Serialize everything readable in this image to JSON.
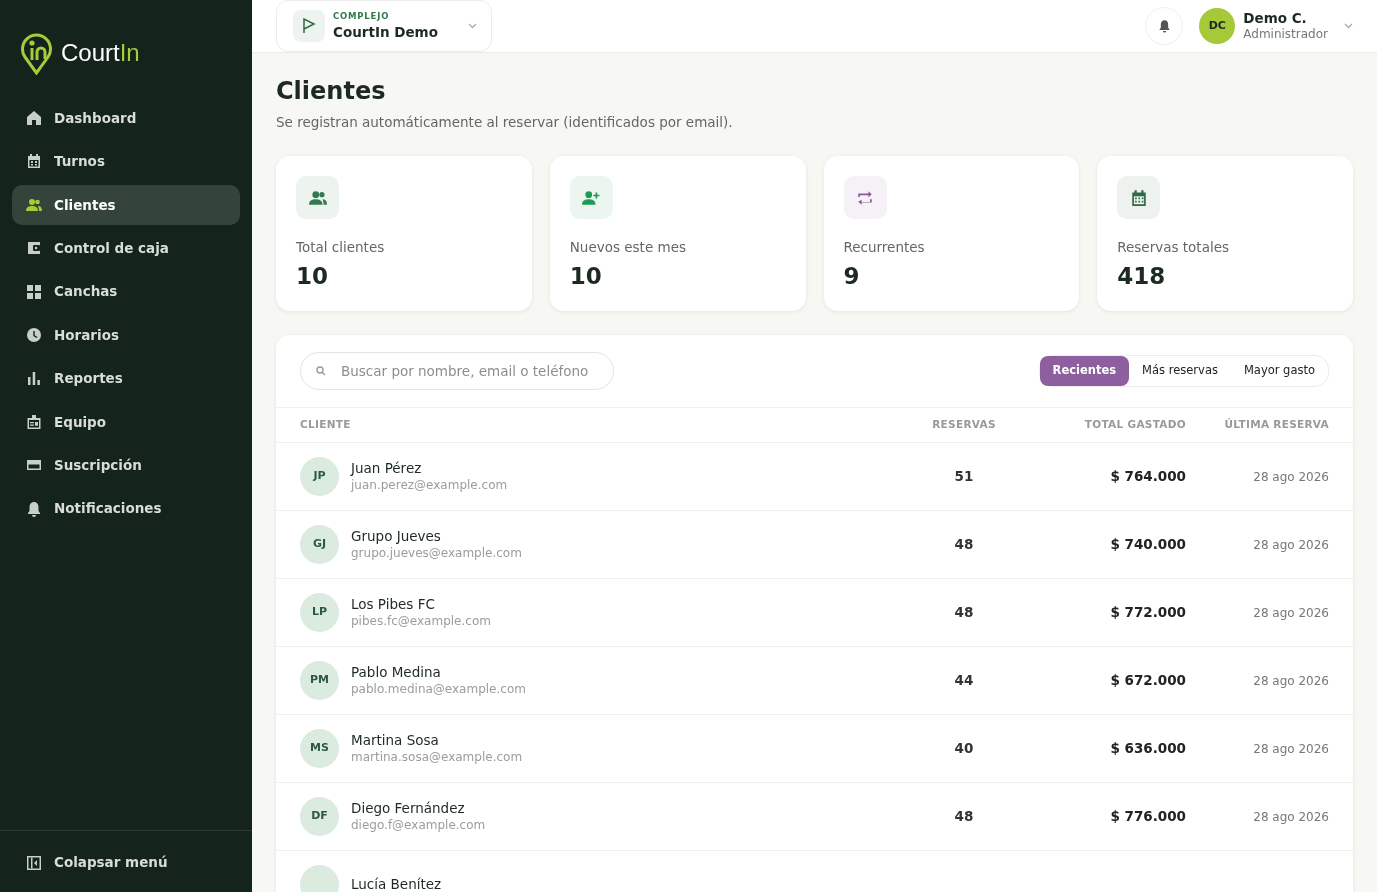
{
  "brand": {
    "name": "Court",
    "name_accent": "In"
  },
  "sidebar": {
    "items": [
      {
        "label": "Dashboard",
        "selected": false
      },
      {
        "label": "Turnos",
        "selected": false
      },
      {
        "label": "Clientes",
        "selected": true
      },
      {
        "label": "Control de caja",
        "selected": false
      },
      {
        "label": "Canchas",
        "selected": false
      },
      {
        "label": "Horarios",
        "selected": false
      },
      {
        "label": "Reportes",
        "selected": false
      },
      {
        "label": "Equipo",
        "selected": false
      },
      {
        "label": "Suscripción",
        "selected": false
      },
      {
        "label": "Notificaciones",
        "selected": false
      }
    ],
    "collapse": "Colapsar menú"
  },
  "header": {
    "complex_label": "COMPLEJO",
    "complex_name": "CourtIn Demo",
    "user": {
      "initials": "DC",
      "name": "Demo C.",
      "role": "Administrador"
    }
  },
  "page": {
    "title": "Clientes",
    "subtitle": "Se registran automáticamente al reservar (identificados por email)."
  },
  "stats": [
    {
      "label": "Total clientes",
      "value": "10",
      "color": "#2f7a4f"
    },
    {
      "label": "Nuevos este mes",
      "value": "10",
      "color": "#1f9a55"
    },
    {
      "label": "Recurrentes",
      "value": "9",
      "color": "#8a5a9a"
    },
    {
      "label": "Reservas totales",
      "value": "418",
      "color": "#2f6a47"
    }
  ],
  "search": {
    "placeholder": "Buscar por nombre, email o teléfono"
  },
  "sort_tabs": [
    {
      "label": "Recientes",
      "selected": true
    },
    {
      "label": "Más reservas",
      "selected": false
    },
    {
      "label": "Mayor gasto",
      "selected": false
    }
  ],
  "table": {
    "columns": [
      "CLIENTE",
      "RESERVAS",
      "TOTAL GASTADO",
      "ÚLTIMA RESERVA"
    ],
    "rows": [
      {
        "initials": "JP",
        "name": "Juan Pérez",
        "email": "juan.perez@example.com",
        "reservas": "51",
        "total": "$ 764.000",
        "last": "28 ago 2026"
      },
      {
        "initials": "GJ",
        "name": "Grupo Jueves",
        "email": "grupo.jueves@example.com",
        "reservas": "48",
        "total": "$ 740.000",
        "last": "28 ago 2026"
      },
      {
        "initials": "LP",
        "name": "Los Pibes FC",
        "email": "pibes.fc@example.com",
        "reservas": "48",
        "total": "$ 772.000",
        "last": "28 ago 2026"
      },
      {
        "initials": "PM",
        "name": "Pablo Medina",
        "email": "pablo.medina@example.com",
        "reservas": "44",
        "total": "$ 672.000",
        "last": "28 ago 2026"
      },
      {
        "initials": "MS",
        "name": "Martina Sosa",
        "email": "martina.sosa@example.com",
        "reservas": "40",
        "total": "$ 636.000",
        "last": "28 ago 2026"
      },
      {
        "initials": "DF",
        "name": "Diego Fernández",
        "email": "diego.f@example.com",
        "reservas": "48",
        "total": "$ 776.000",
        "last": "28 ago 2026"
      },
      {
        "name": "Lucía Benítez"
      }
    ]
  }
}
